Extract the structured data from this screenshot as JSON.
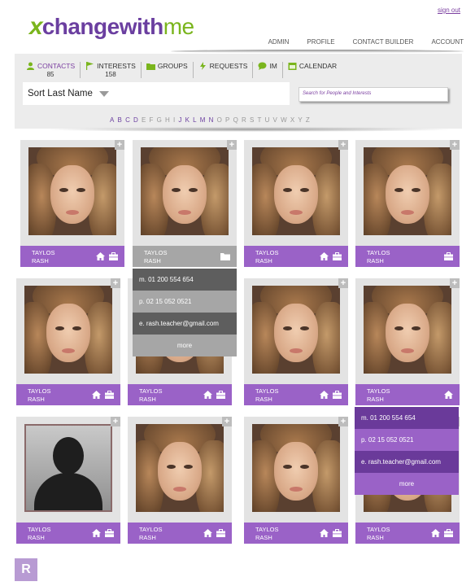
{
  "header": {
    "logo": {
      "x": "x",
      "part1": "changewith",
      "part2": "me"
    },
    "signout": "sign out",
    "nav": [
      "ADMIN",
      "PROFILE",
      "CONTACT BUILDER",
      "ACCOUNT"
    ]
  },
  "tabs": [
    {
      "label": "CONTACTS",
      "count": "85",
      "icon": "person-icon",
      "active": true
    },
    {
      "label": "INTERESTS",
      "count": "158",
      "icon": "flag-icon",
      "active": false
    },
    {
      "label": "GROUPS",
      "count": "",
      "icon": "folder-icon",
      "active": false
    },
    {
      "label": "REQUESTS",
      "count": "",
      "icon": "lightning-icon",
      "active": false
    },
    {
      "label": "IM",
      "count": "",
      "icon": "chat-bubble-icon",
      "active": false
    },
    {
      "label": "CALENDAR",
      "count": "",
      "icon": "calendar-icon",
      "active": false
    }
  ],
  "sort": {
    "label": "Sort Last Name"
  },
  "search": {
    "placeholder": "Search for People and Interests"
  },
  "alphabet": [
    {
      "l": "A",
      "on": true
    },
    {
      "l": "B",
      "on": true
    },
    {
      "l": "C",
      "on": true
    },
    {
      "l": "D",
      "on": true
    },
    {
      "l": "E",
      "on": false
    },
    {
      "l": "F",
      "on": false
    },
    {
      "l": "G",
      "on": false
    },
    {
      "l": "H",
      "on": false
    },
    {
      "l": "I",
      "on": false
    },
    {
      "l": "J",
      "on": true
    },
    {
      "l": "K",
      "on": true
    },
    {
      "l": "L",
      "on": true
    },
    {
      "l": "M",
      "on": true
    },
    {
      "l": "N",
      "on": true
    },
    {
      "l": "O",
      "on": false
    },
    {
      "l": "P",
      "on": false
    },
    {
      "l": "Q",
      "on": false
    },
    {
      "l": "R",
      "on": false
    },
    {
      "l": "S",
      "on": false
    },
    {
      "l": "T",
      "on": false
    },
    {
      "l": "U",
      "on": false
    },
    {
      "l": "V",
      "on": false
    },
    {
      "l": "W",
      "on": false
    },
    {
      "l": "X",
      "on": false
    },
    {
      "l": "Y",
      "on": false
    },
    {
      "l": "Z",
      "on": false
    }
  ],
  "plus": "+",
  "cards": [
    {
      "first": "TAYLOS",
      "last": "RASH",
      "icons": [
        "home-icon",
        "briefcase-icon"
      ],
      "photo": "face",
      "bar": "purple"
    },
    {
      "first": "TAYLOS",
      "last": "RASH",
      "icons": [
        "folder-icon"
      ],
      "photo": "face",
      "bar": "grey"
    },
    {
      "first": "TAYLOS",
      "last": "RASH",
      "icons": [
        "home-icon",
        "briefcase-icon"
      ],
      "photo": "face",
      "bar": "purple"
    },
    {
      "first": "TAYLOS",
      "last": "RASH",
      "icons": [
        "briefcase-icon"
      ],
      "photo": "face",
      "bar": "purple"
    },
    {
      "first": "TAYLOS",
      "last": "RASH",
      "icons": [
        "home-icon",
        "briefcase-icon"
      ],
      "photo": "face",
      "bar": "purple"
    },
    {
      "first": "TAYLOS",
      "last": "RASH",
      "icons": [
        "home-icon",
        "briefcase-icon"
      ],
      "photo": "face",
      "bar": "purple"
    },
    {
      "first": "TAYLOS",
      "last": "RASH",
      "icons": [
        "home-icon",
        "briefcase-icon"
      ],
      "photo": "face",
      "bar": "purple"
    },
    {
      "first": "TAYLOS",
      "last": "RASH",
      "icons": [
        "home-icon"
      ],
      "photo": "face",
      "bar": "purple"
    },
    {
      "first": "TAYLOS",
      "last": "RASH",
      "icons": [
        "home-icon",
        "briefcase-icon"
      ],
      "photo": "silhouette",
      "bar": "purple"
    },
    {
      "first": "TAYLOS",
      "last": "RASH",
      "icons": [
        "home-icon",
        "briefcase-icon"
      ],
      "photo": "face",
      "bar": "purple"
    },
    {
      "first": "TAYLOS",
      "last": "RASH",
      "icons": [
        "home-icon",
        "briefcase-icon"
      ],
      "photo": "face",
      "bar": "purple"
    },
    {
      "first": "TAYLOS",
      "last": "RASH",
      "icons": [
        "home-icon",
        "briefcase-icon"
      ],
      "photo": "face",
      "bar": "purple"
    }
  ],
  "dropdown_grey": {
    "mobile": "m. 01 200 554 654",
    "phone": "p. 02 15 052 0521",
    "email": "e. rash.teacher@gmail.com",
    "more": "more",
    "colors": [
      "#5e5e5e",
      "#a6a6a6",
      "#5e5e5e",
      "#a6a6a6"
    ]
  },
  "dropdown_purple": {
    "mobile": "m. 01 200 554 654",
    "phone": "p. 02 15 052 0521",
    "email": "e. rash.teacher@gmail.com",
    "more": "more",
    "colors": [
      "#6a3a9a",
      "#9a62c7",
      "#6a3a9a",
      "#9a62c7"
    ]
  },
  "badge": "R"
}
